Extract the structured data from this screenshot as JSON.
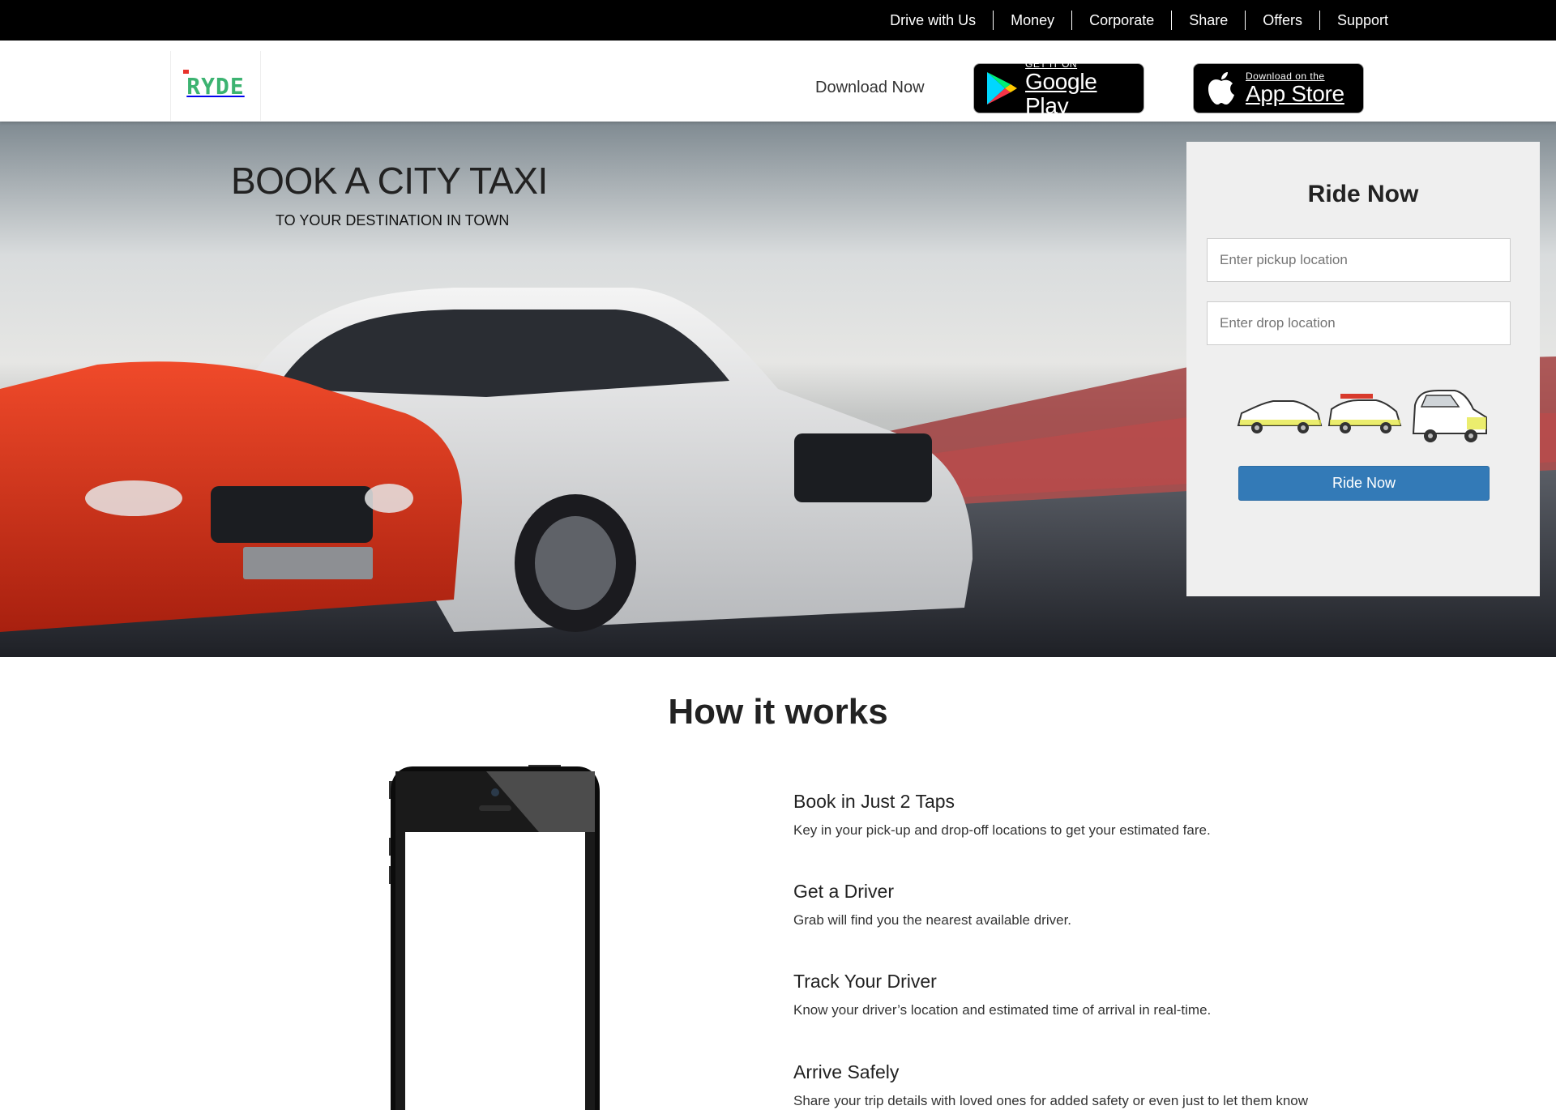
{
  "topnav": {
    "items": [
      {
        "label": "Drive with Us"
      },
      {
        "label": "Money"
      },
      {
        "label": "Corporate"
      },
      {
        "label": "Share"
      },
      {
        "label": "Offers"
      },
      {
        "label": "Support"
      }
    ]
  },
  "header": {
    "logo_text": "RYDE",
    "download_label": "Download Now",
    "google_play": {
      "small": "GET IT ON",
      "big": "Google Play"
    },
    "app_store": {
      "small": "Download on the",
      "big": "App Store"
    }
  },
  "hero": {
    "title": "BOOK A CITY TAXI",
    "subtitle": "TO YOUR DESTINATION IN TOWN"
  },
  "ride_panel": {
    "title": "Ride Now",
    "pickup_placeholder": "Enter pickup location",
    "drop_placeholder": "Enter drop location",
    "button_label": "Ride Now"
  },
  "how_it_works": {
    "title": "How it works",
    "steps": [
      {
        "title": "Book in Just 2 Taps",
        "text": "Key in your pick-up and drop-off locations to get your estimated fare."
      },
      {
        "title": "Get a Driver",
        "text": "Grab will find you the nearest available driver."
      },
      {
        "title": "Track Your Driver",
        "text": "Know your driver’s location and estimated time of arrival in real-time."
      },
      {
        "title": "Arrive Safely",
        "text": "Share your trip details with loved ones for added safety or even just to let them know"
      }
    ]
  },
  "colors": {
    "topbar": "#000000",
    "accent_button": "#337ab7",
    "logo_green": "#3cb371",
    "logo_red": "#e8322b",
    "panel_bg": "#efefef"
  }
}
